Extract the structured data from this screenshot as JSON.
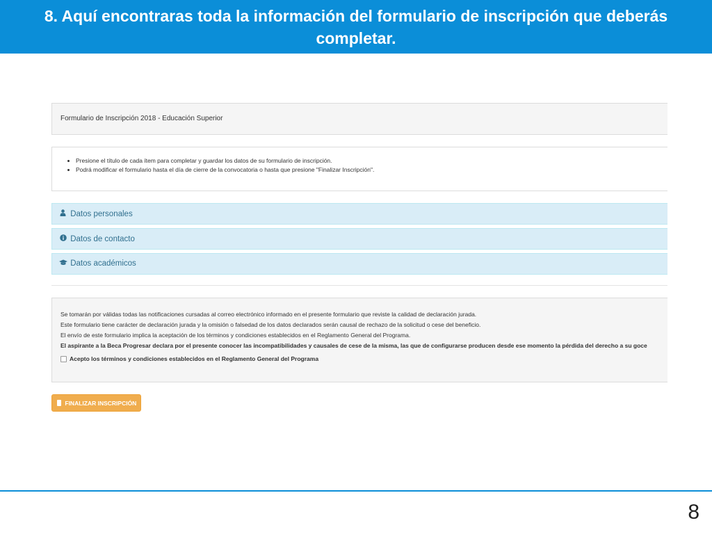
{
  "slide": {
    "title": "8. Aquí encontraras toda la información del formulario de inscripción que deberás completar.",
    "page_number": "8"
  },
  "form": {
    "title": "Formulario de Inscripción 2018 - Educación Superior",
    "instructions": [
      "Presione el título de cada ítem para completar y guardar los datos de su formulario de inscripción.",
      "Podrá modificar el formulario hasta el día de cierre de la convocatoria o hasta que presione \"Finalizar Inscripción\"."
    ],
    "sections": [
      {
        "label": "Datos personales",
        "icon": "user-icon"
      },
      {
        "label": "Datos de contacto",
        "icon": "info-circle-icon"
      },
      {
        "label": "Datos académicos",
        "icon": "graduation-cap-icon"
      }
    ],
    "terms": [
      "Se tomarán por válidas todas las notificaciones cursadas al correo electrónico informado en el presente formulario que reviste la calidad de declaración jurada.",
      "Este formulario tiene carácter de declaración jurada y la omisión o falsedad de los datos declarados serán causal de rechazo de la solicitud o cese del beneficio.",
      "El envío de este formulario implica la aceptación de los términos y condiciones establecidos en el Reglamento General del Programa.",
      "El aspirante a la Beca Progresar declara por el presente conocer las incompatibilidades y causales de cese de la misma, las que de configurarse producen desde ese momento la pérdida del derecho a su goce"
    ],
    "accept_label": "Acepto los términos y condiciones establecidos en el Reglamento General del Programa",
    "finish_button": "FINALIZAR INSCRIPCIÓN"
  },
  "colors": {
    "header_bg": "#0b8ed8",
    "accordion_bg": "#d9edf7",
    "accordion_text": "#31708f",
    "button_bg": "#f0ad4e"
  }
}
